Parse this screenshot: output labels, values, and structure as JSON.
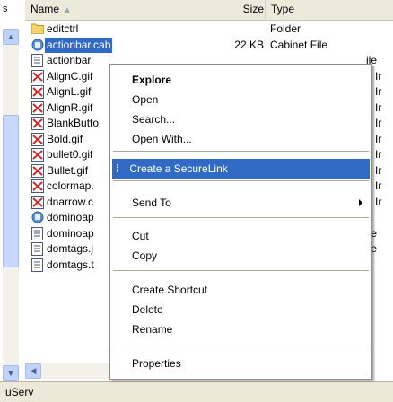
{
  "left_pane": {
    "label": "s",
    "text": "<"
  },
  "columns": {
    "name": "Name",
    "size": "Size",
    "type": "Type"
  },
  "files": [
    {
      "name": "editctrl",
      "size": "",
      "type": "Folder",
      "icon": "folder-icon",
      "trunc": ""
    },
    {
      "name": "actionbar.cab",
      "size": "22 KB",
      "type": "Cabinet File",
      "icon": "cabinet-file-icon",
      "trunc": ""
    },
    {
      "name": "actionbar.",
      "size": "",
      "type": "",
      "icon": "text-file-icon",
      "trunc": "ile"
    },
    {
      "name": "AlignC.gif",
      "size": "",
      "type": "",
      "icon": "gif-image-icon",
      "trunc": "7 Ir"
    },
    {
      "name": "AlignL.gif",
      "size": "",
      "type": "",
      "icon": "gif-image-icon",
      "trunc": "7 Ir"
    },
    {
      "name": "AlignR.gif",
      "size": "",
      "type": "",
      "icon": "gif-image-icon",
      "trunc": "7 Ir"
    },
    {
      "name": "BlankButto",
      "size": "",
      "type": "",
      "icon": "gif-image-icon",
      "trunc": "7 Ir"
    },
    {
      "name": "Bold.gif",
      "size": "",
      "type": "",
      "icon": "gif-image-icon",
      "trunc": "7 Ir"
    },
    {
      "name": "bullet0.gif",
      "size": "",
      "type": "",
      "icon": "gif-image-icon",
      "trunc": "7 Ir"
    },
    {
      "name": "Bullet.gif",
      "size": "",
      "type": "",
      "icon": "gif-image-icon",
      "trunc": "7 Ir"
    },
    {
      "name": "colormap.",
      "size": "",
      "type": "",
      "icon": "gif-image-icon",
      "trunc": "7 Ir"
    },
    {
      "name": "dnarrow.c",
      "size": "",
      "type": "",
      "icon": "gif-image-icon",
      "trunc": "7 Ir"
    },
    {
      "name": "dominoap",
      "size": "",
      "type": "",
      "icon": "cabinet-file-icon",
      "trunc": ""
    },
    {
      "name": "dominoap",
      "size": "",
      "type": "",
      "icon": "text-file-icon",
      "trunc": "ile"
    },
    {
      "name": "domtags.j",
      "size": "",
      "type": "",
      "icon": "text-file-icon",
      "trunc": "ile"
    },
    {
      "name": "domtags.t",
      "size": "",
      "type": "",
      "icon": "text-file-icon",
      "trunc": ""
    }
  ],
  "status": {
    "text": "uServ"
  },
  "menu": {
    "explore": "Explore",
    "open": "Open",
    "search": "Search...",
    "open_with": "Open With...",
    "create_securelink": "Create a SecureLink",
    "send_to": "Send To",
    "cut": "Cut",
    "copy": "Copy",
    "create_shortcut": "Create Shortcut",
    "delete": "Delete",
    "rename": "Rename",
    "properties": "Properties"
  },
  "colors": {
    "selection": "#316ac5",
    "menu_border": "#8d8d8d",
    "window_bg": "#ece9d8"
  }
}
